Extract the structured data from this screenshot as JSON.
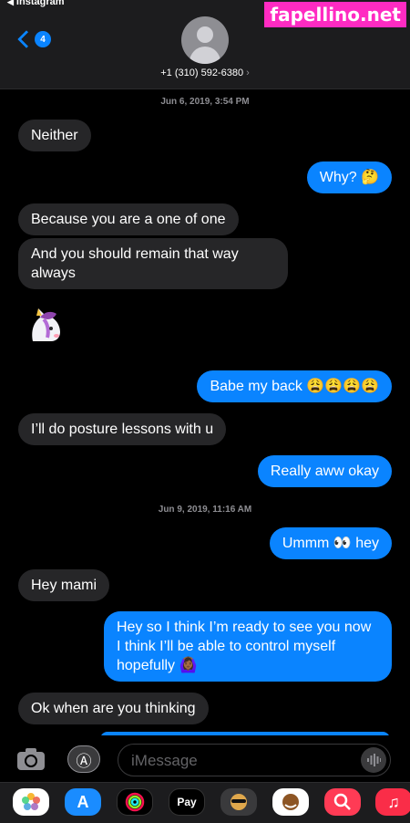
{
  "status": {
    "back_app": "Instagram"
  },
  "watermark": "fapellino.net",
  "header": {
    "back_badge": "4",
    "contact": "+1 (310) 592-6380",
    "contact_arrow": "›"
  },
  "timestamps": [
    "Jun 6, 2019, 3:54 PM",
    "Jun 9, 2019, 11:16 AM"
  ],
  "messages": [
    {
      "dir": "in",
      "text": "Neither"
    },
    {
      "dir": "out",
      "text": "Why? 🤔"
    },
    {
      "dir": "in",
      "text": "Because you are a one of one"
    },
    {
      "dir": "in",
      "text": "And you should remain that way always"
    },
    {
      "dir": "in",
      "text": "🦄",
      "emoji_only": true
    },
    {
      "dir": "out",
      "text": "Babe my back 😩😩😩😩"
    },
    {
      "dir": "in",
      "text": "I’ll do posture lessons with u"
    },
    {
      "dir": "out",
      "text": "Really aww okay"
    },
    {
      "dir": "out",
      "text": "Ummm 👀 hey"
    },
    {
      "dir": "in",
      "text": "Hey mami"
    },
    {
      "dir": "out",
      "text": "Hey so I think I’m ready to see you now I think I’ll be able to control myself hopefully 🙆🏾‍♀️"
    },
    {
      "dir": "in",
      "text": "Ok when are you thinking"
    }
  ],
  "input": {
    "placeholder": "iMessage"
  },
  "apps": [
    {
      "name": "photos",
      "label": "",
      "color": "#ffffff"
    },
    {
      "name": "app-store",
      "label": "A",
      "color": "#1a8cff"
    },
    {
      "name": "activity",
      "label": "",
      "color": "#000000"
    },
    {
      "name": "apple-pay",
      "label": "Pay",
      "color": "#000000"
    },
    {
      "name": "memoji-1",
      "label": "",
      "color": "#3a3a3c"
    },
    {
      "name": "memoji-2",
      "label": "",
      "color": "#ffffff"
    },
    {
      "name": "search",
      "label": "",
      "color": "#ff3b55"
    },
    {
      "name": "music",
      "label": "♫",
      "color": "#fa2d48"
    }
  ]
}
